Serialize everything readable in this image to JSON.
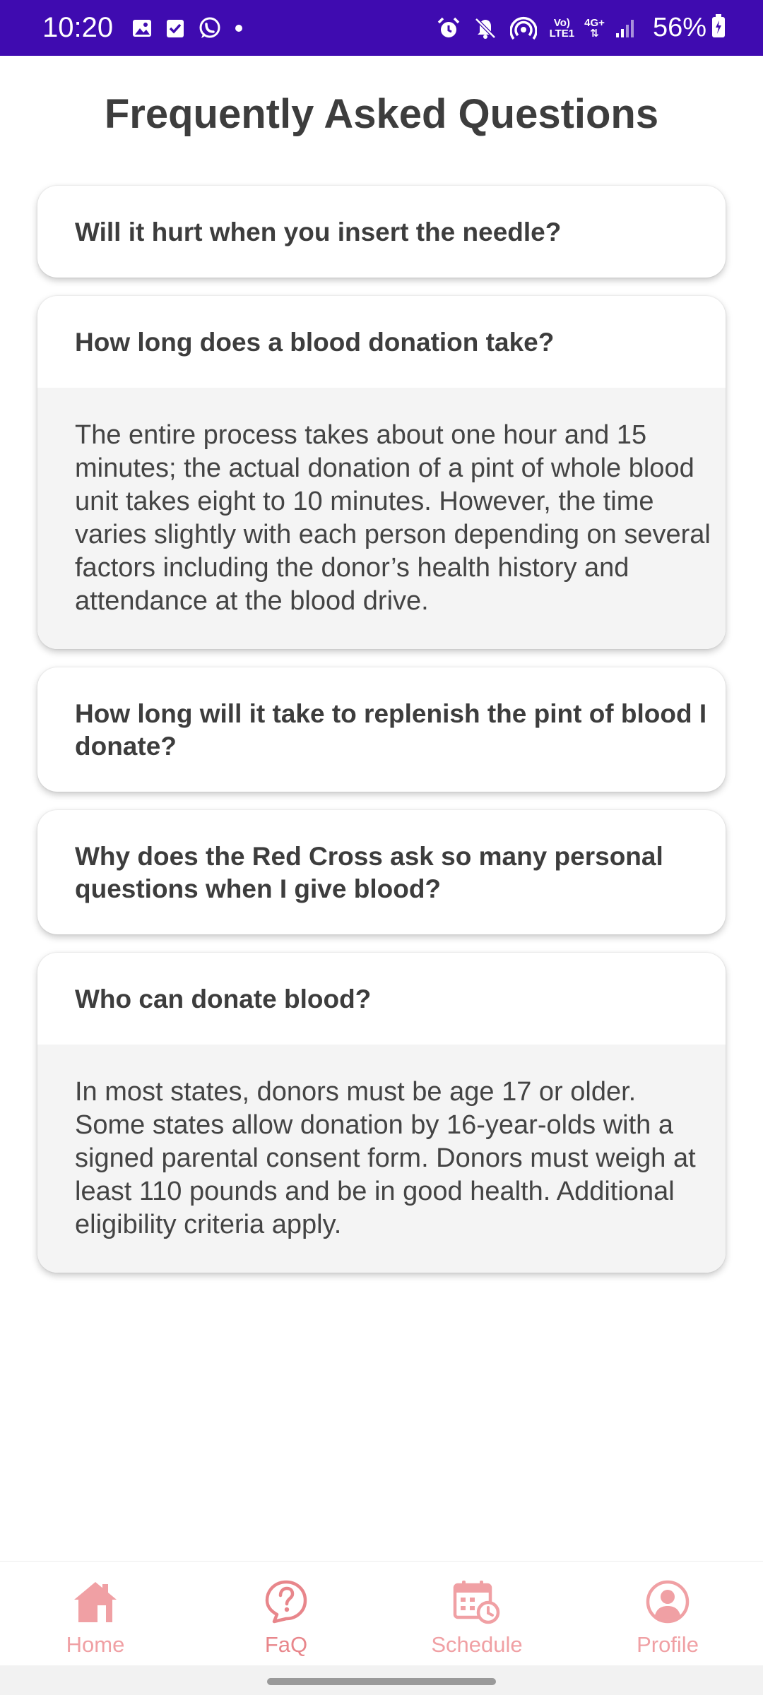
{
  "status_bar": {
    "time": "10:20",
    "network_top": "Vo)",
    "network_bottom": "LTE1",
    "network_gen": "4G+",
    "battery": "56%",
    "background": "#3f0bb0"
  },
  "page": {
    "title": "Frequently Asked Questions"
  },
  "faq": {
    "items": [
      {
        "question": "Will it hurt when you insert the needle?",
        "answer": null,
        "expanded": false
      },
      {
        "question": "How long does a blood donation take?",
        "answer": "The entire process takes about one hour and 15 minutes; the actual donation of a pint of whole blood unit takes eight to 10 minutes. However, the time varies slightly with each person depending on several factors including the donor’s health history and attendance at the blood drive.",
        "expanded": true
      },
      {
        "question": "How long will it take to replenish the pint of blood I donate?",
        "answer": null,
        "expanded": false
      },
      {
        "question": "Why does the Red Cross ask so many personal questions when I give blood?",
        "answer": null,
        "expanded": false
      },
      {
        "question": "Who can donate blood?",
        "answer": "In most states, donors must be age 17 or older. Some states allow donation by 16-year-olds with a signed parental consent form. Donors must weigh at least 110 pounds and be in good health. Additional eligibility criteria apply.",
        "expanded": true
      }
    ]
  },
  "bottom_nav": {
    "items": [
      {
        "label": "Home",
        "icon": "home-icon",
        "active": false
      },
      {
        "label": "FaQ",
        "icon": "question-icon",
        "active": true
      },
      {
        "label": "Schedule",
        "icon": "calendar-clock-icon",
        "active": false
      },
      {
        "label": "Profile",
        "icon": "profile-icon",
        "active": false
      }
    ],
    "accent": "#e8868b"
  }
}
